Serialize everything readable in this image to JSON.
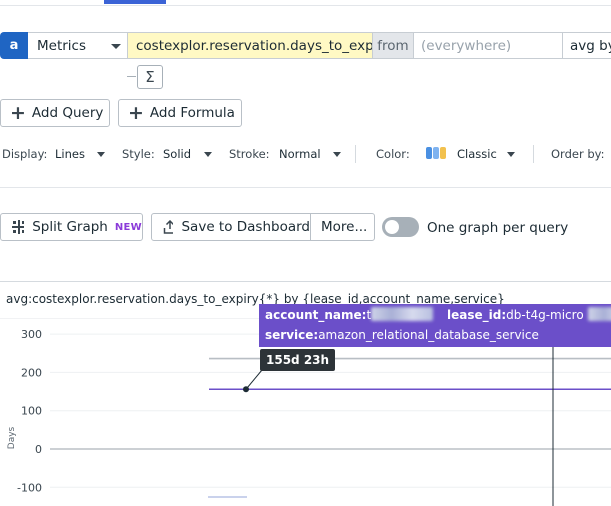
{
  "query": {
    "letter": "a",
    "source": "Metrics",
    "metric": "costexplor.reservation.days_to_expiry",
    "from_label": "from",
    "scope_placeholder": "(everywhere)",
    "aggregation": "avg by"
  },
  "formula_icon": "Σ",
  "buttons": {
    "add_query": "Add Query",
    "add_formula": "Add Formula",
    "split_graph": "Split Graph",
    "split_graph_badge": "NEW",
    "save_to_dashboard": "Save to Dashboard",
    "more": "More...",
    "one_graph_per_query": "One graph per query"
  },
  "display_options": {
    "display_label": "Display:",
    "display_value": "Lines",
    "style_label": "Style:",
    "style_value": "Solid",
    "stroke_label": "Stroke:",
    "stroke_value": "Normal",
    "color_label": "Color:",
    "color_value": "Classic",
    "palette_colors": [
      "#4a90e2",
      "#7fb3f0",
      "#f2c14e"
    ],
    "order_label": "Order by:"
  },
  "toggle_state": false,
  "graph": {
    "title": "avg:costexplor.reservation.days_to_expiry{*} by {lease_id,account_name,service}",
    "y_axis_label": "Days",
    "y_ticks": [
      "300",
      "200",
      "100",
      "0",
      "-100"
    ]
  },
  "tooltip": {
    "account_key": "account_name:",
    "account_value_prefix": "t",
    "lease_key": "lease_id:",
    "lease_value": "db-t4g-micro",
    "service_key": "service:",
    "service_value": "amazon_relational_database_service",
    "value": "155d 23h"
  },
  "chart_data": {
    "type": "line",
    "ylabel": "Days",
    "y_ticks": [
      300,
      200,
      100,
      0,
      -100
    ],
    "series": [
      {
        "values": [
          236,
          236
        ],
        "color": "#b8bec4"
      },
      {
        "values": [
          156,
          156
        ],
        "color": "#6b4fc9"
      },
      {
        "values": [
          0,
          0
        ],
        "color": "#9aa2aa"
      }
    ],
    "color_accent": "#6b4fc9"
  }
}
